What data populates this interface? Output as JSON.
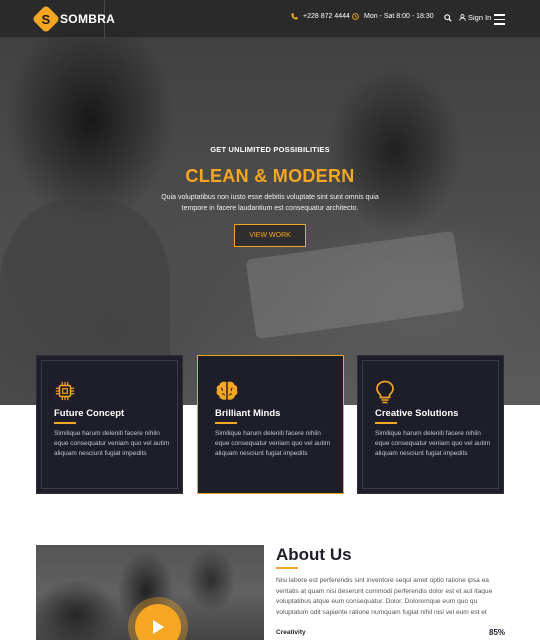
{
  "header": {
    "brand": "SOMBRA",
    "logo_letter": "S",
    "phone": "+228 872 4444",
    "hours": "Mon - Sat 8:00 - 18:30",
    "signin_label": "Sign In"
  },
  "hero": {
    "kicker": "GET UNLIMITED POSSIBILITIES",
    "title": "CLEAN & MODERN",
    "text": "Quia voluptatibus non iusto esse debitis voluptate sint sunt omnis quia tempore in facere laudantium est consequatur architecto.",
    "button_label": "VIEW WORK"
  },
  "features": [
    {
      "icon": "chip-icon",
      "title": "Future Concept",
      "text": "Similique harum deleniti facere nihiln eque consequatur veniam quo vel autim aliquam nesciunt fugiat impedits"
    },
    {
      "icon": "brain-icon",
      "title": "Brilliant Minds",
      "text": "Similique harum deleniti facere nihiln eque consequatur veniam quo vel autim aliquam nesciunt fugiat impedits"
    },
    {
      "icon": "lightbulb-icon",
      "title": "Creative Solutions",
      "text": "Similique harum deleniti facere nihiln eque consequatur veniam quo vel autim aliquam nesciunt fugiat impedits"
    }
  ],
  "about": {
    "title": "About Us",
    "text": "Nisi labore est perferendis sint inventore sequi amet optio ratione ipsa ea veritatis at quam nisi deserunt commodi perferendis dolor est et aut itaque voluptatibus atque eum consequatur. Dolor. Doloremque eum quo qu voluptatum odit sapiente ratione numquam fugiat nihil nisi vel eum est et",
    "skills": [
      {
        "label": "Creativity",
        "value": "85%"
      }
    ]
  },
  "colors": {
    "accent": "#f5a623",
    "dark": "#1d1e29"
  }
}
